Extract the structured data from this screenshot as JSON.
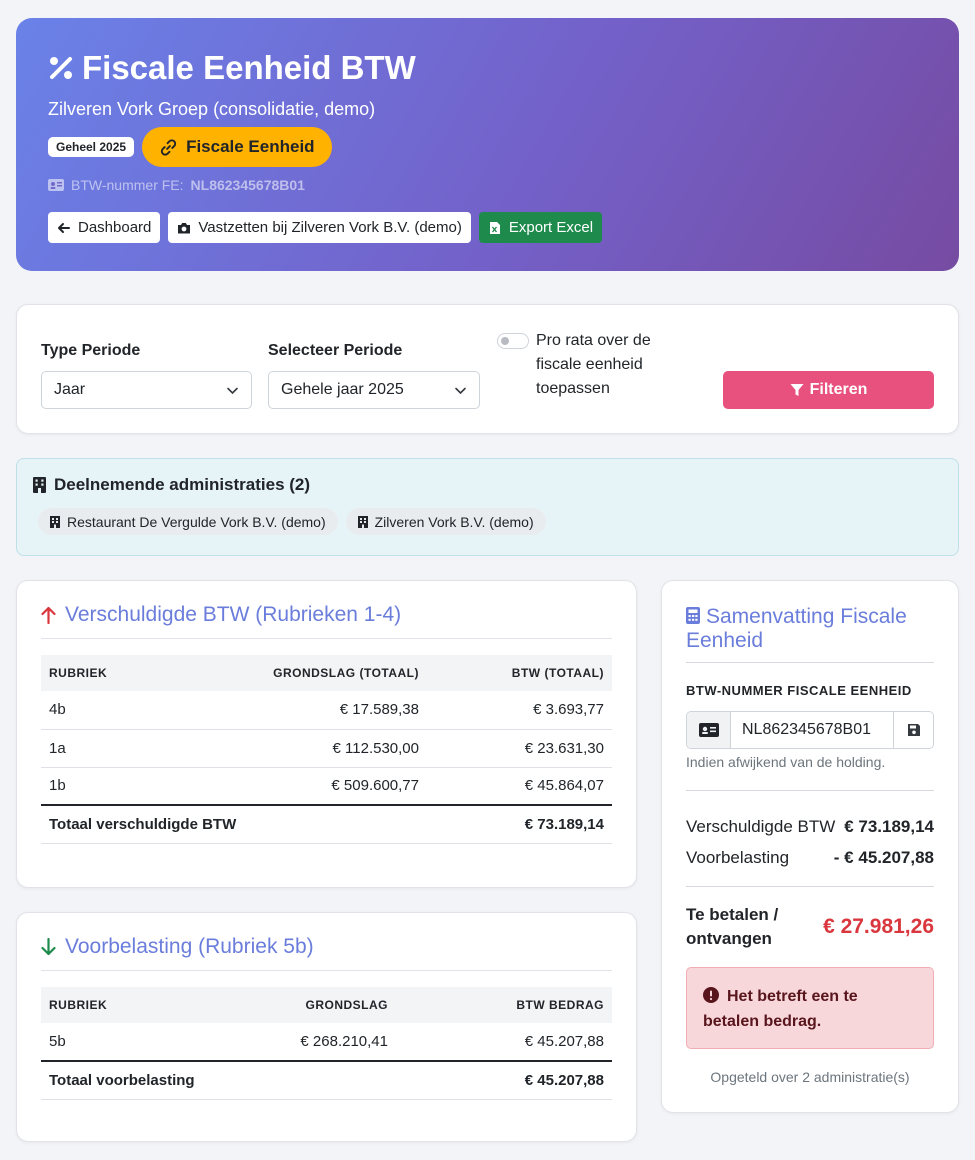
{
  "header": {
    "title": "Fiscale Eenheid BTW",
    "subtitle": "Zilveren Vork Groep (consolidatie, demo)",
    "period_badge": "Geheel 2025",
    "fe_badge": "Fiscale Eenheid",
    "vat_label": "BTW-nummer FE:",
    "vat_number": "NL862345678B01",
    "actions": {
      "dashboard": "Dashboard",
      "lock": "Vastzetten bij Zilveren Vork B.V. (demo)",
      "export": "Export Excel"
    }
  },
  "filters": {
    "type_label": "Type Periode",
    "type_value": "Jaar",
    "period_label": "Selecteer Periode",
    "period_value": "Gehele jaar 2025",
    "prorata_label": "Pro rata over de fiscale eenheid toepassen",
    "prorata_on": false,
    "filter_button": "Filteren"
  },
  "participants": {
    "title": "Deelnemende administraties (2)",
    "items": [
      "Restaurant De Vergulde Vork B.V. (demo)",
      "Zilveren Vork B.V. (demo)"
    ]
  },
  "owed": {
    "title": "Verschuldigde BTW (Rubrieken 1-4)",
    "headers": [
      "RUBRIEK",
      "GRONDSLAG (TOTAAL)",
      "BTW (TOTAAL)"
    ],
    "rows": [
      [
        "4b",
        "€ 17.589,38",
        "€ 3.693,77"
      ],
      [
        "1a",
        "€ 112.530,00",
        "€ 23.631,30"
      ],
      [
        "1b",
        "€ 509.600,77",
        "€ 45.864,07"
      ]
    ],
    "total_label": "Totaal verschuldigde BTW",
    "total_value": "€ 73.189,14"
  },
  "input_tax": {
    "title": "Voorbelasting (Rubriek 5b)",
    "headers": [
      "RUBRIEK",
      "GRONDSLAG",
      "BTW BEDRAG"
    ],
    "rows": [
      [
        "5b",
        "€ 268.210,41",
        "€ 45.207,88"
      ]
    ],
    "total_label": "Totaal voorbelasting",
    "total_value": "€ 45.207,88"
  },
  "summary": {
    "title": "Samenvatting Fiscale Eenheid",
    "vat_label": "BTW-NUMMER FISCALE EENHEID",
    "vat_value": "NL862345678B01",
    "help": "Indien afwijkend van de holding.",
    "owed_label": "Verschuldigde BTW",
    "owed_value": "€ 73.189,14",
    "input_label": "Voorbelasting",
    "input_value": "- € 45.207,88",
    "pay_label": "Te betalen / ontvangen",
    "pay_value": "€ 27.981,26",
    "alert": "Het betreft een te betalen bedrag.",
    "footer": "Opgeteld over 2 administratie(s)"
  },
  "colors": {
    "accent": "#6a7ddb",
    "filter_button": "#e8507d",
    "fe_badge": "#ffb300",
    "export": "#1e8a4c",
    "negative": "#d9363e",
    "arrow_up": "#d9363e",
    "arrow_down": "#1e8a4c"
  },
  "icons": {
    "title": "percent-icon",
    "fe_badge": "link-icon",
    "vat": "id-card-icon",
    "dashboard": "arrow-left-icon",
    "lock": "camera-icon",
    "export": "file-excel-icon",
    "filter": "filter-icon",
    "participants": "building-icon",
    "owed": "arrow-up-icon",
    "input_tax": "arrow-down-icon",
    "summary": "calculator-icon",
    "save": "save-icon",
    "alert": "exclamation-circle-icon"
  }
}
